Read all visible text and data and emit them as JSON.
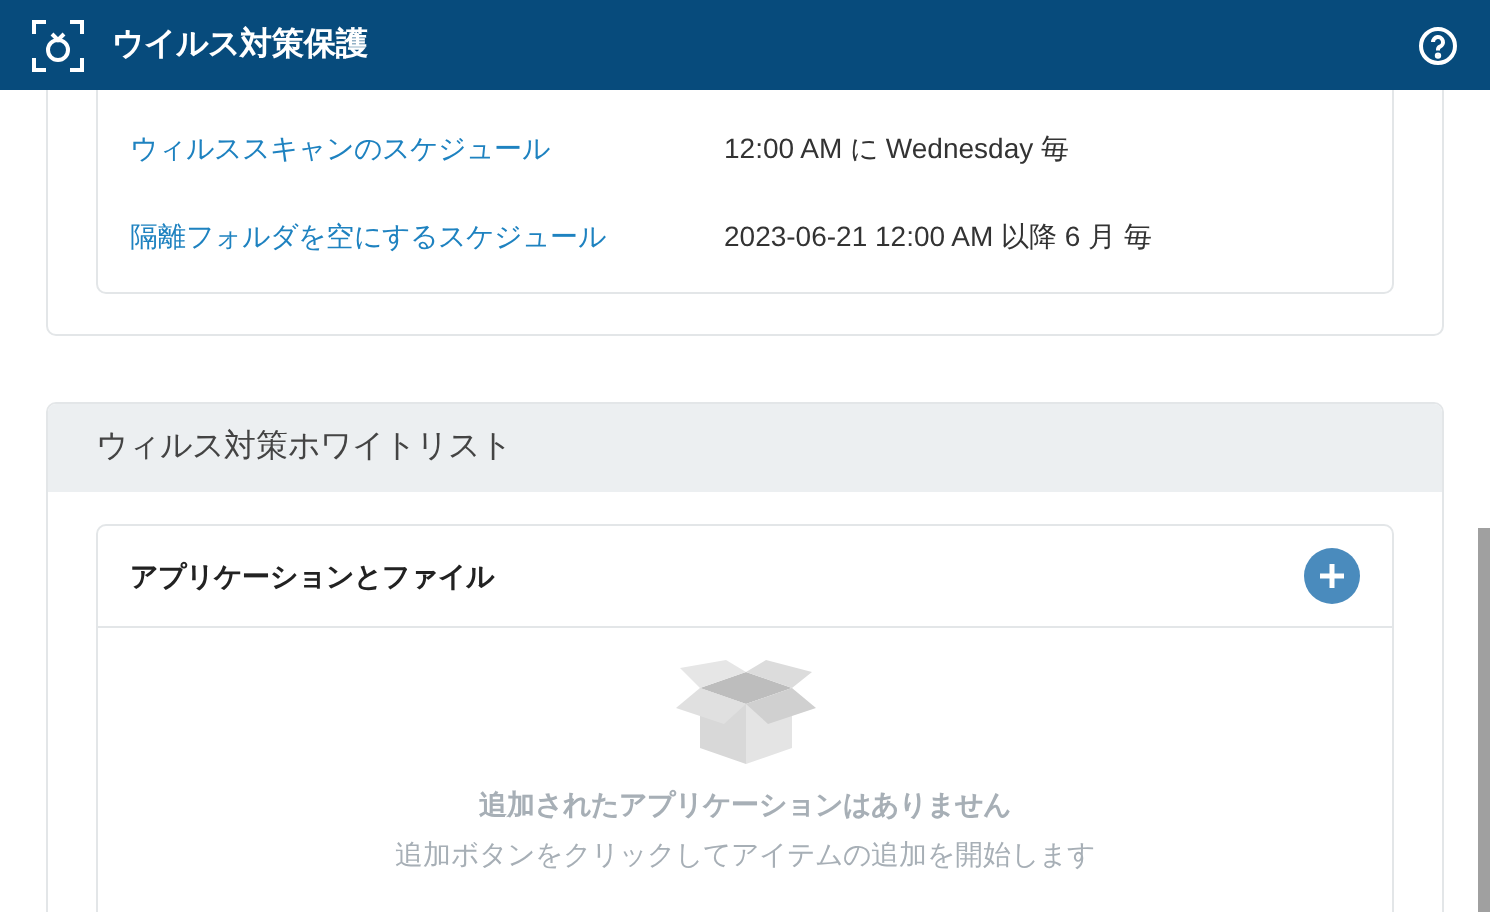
{
  "header": {
    "title": "ウイルス対策保護"
  },
  "schedules": [
    {
      "label": "ウィルススキャンのスケジュール",
      "value": "12:00 AM に Wednesday 毎"
    },
    {
      "label": "隔離フォルダを空にするスケジュール",
      "value": "2023-06-21 12:00 AM 以降 6 月 毎"
    }
  ],
  "whitelist": {
    "title": "ウィルス対策ホワイトリスト",
    "section_title": "アプリケーションとファイル",
    "empty_title": "追加されたアプリケーションはありません",
    "empty_hint": "追加ボタンをクリックしてアイテムの追加を開始します"
  }
}
